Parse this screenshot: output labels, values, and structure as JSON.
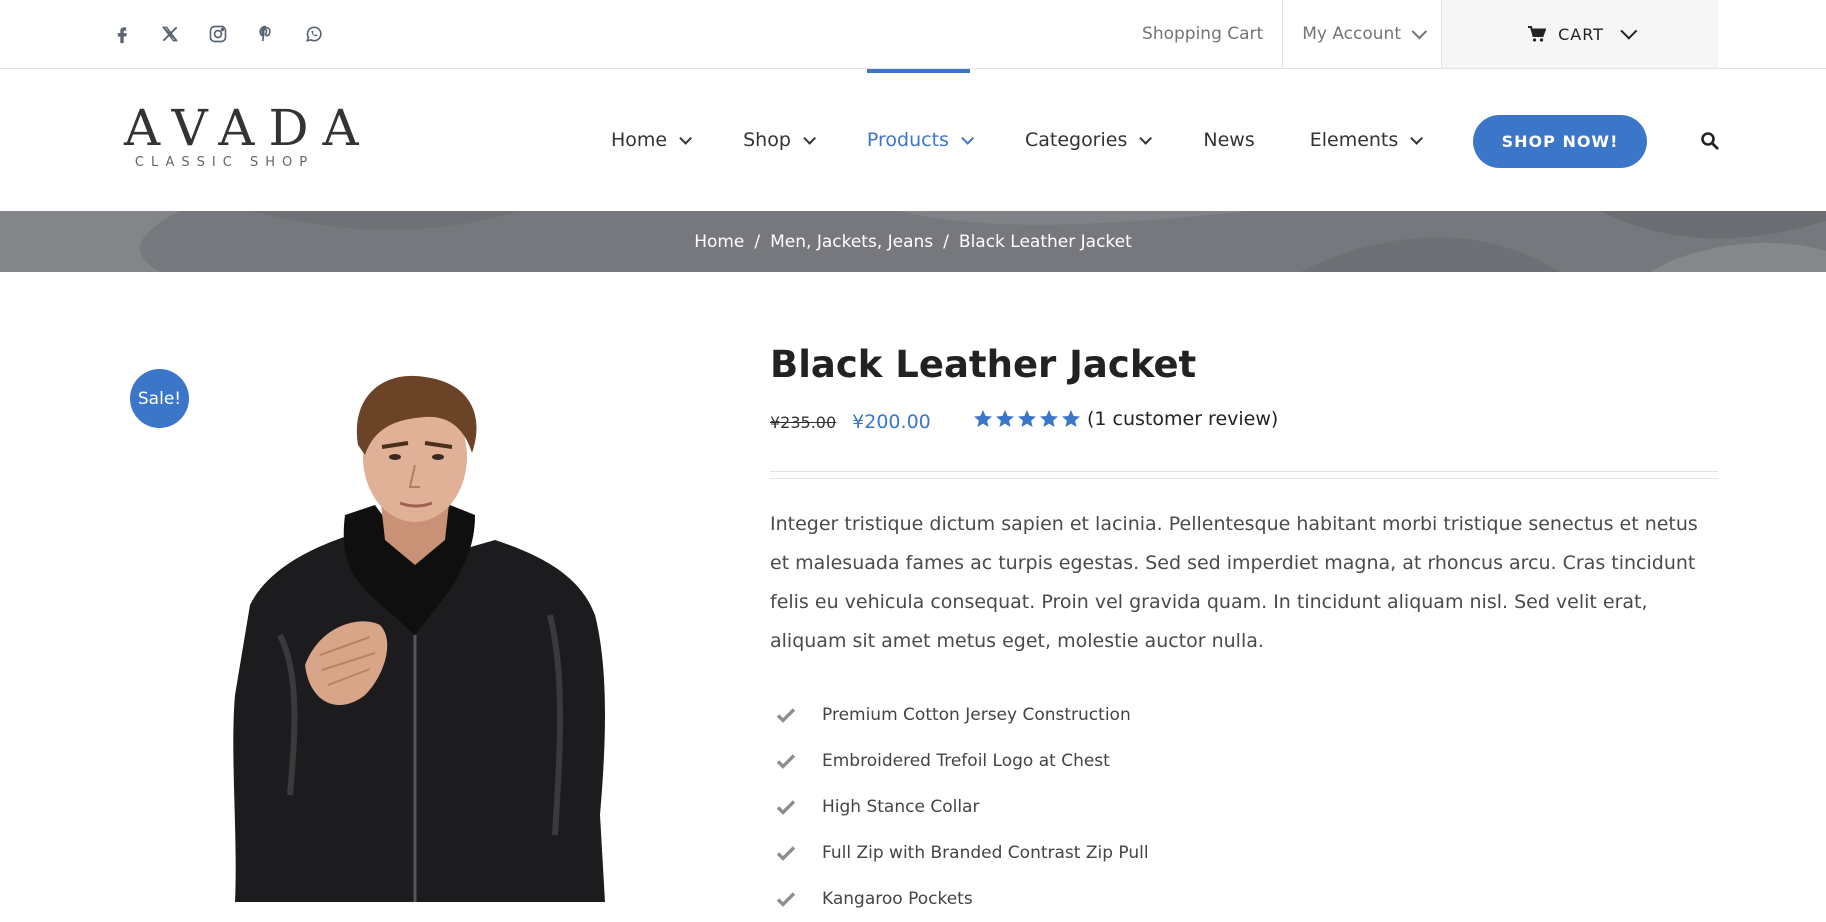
{
  "topbar": {
    "social": [
      "facebook-icon",
      "x-twitter-icon",
      "instagram-icon",
      "pinterest-icon",
      "whatsapp-icon"
    ],
    "links": {
      "shopping_cart": "Shopping Cart",
      "my_account": "My Account",
      "cart": "CART"
    }
  },
  "logo": {
    "brand": "AVADA",
    "sub": "CLASSIC SHOP"
  },
  "nav": {
    "items": [
      {
        "label": "Home",
        "has_dropdown": true
      },
      {
        "label": "Shop",
        "has_dropdown": true
      },
      {
        "label": "Products",
        "has_dropdown": true,
        "active": true
      },
      {
        "label": "Categories",
        "has_dropdown": true
      },
      {
        "label": "News",
        "has_dropdown": false
      },
      {
        "label": "Elements",
        "has_dropdown": true
      }
    ],
    "cta": "SHOP NOW!"
  },
  "breadcrumb": {
    "home": "Home",
    "category": "Men, Jackets, Jeans",
    "current": "Black Leather Jacket",
    "separator": "/"
  },
  "product": {
    "sale_badge": "Sale!",
    "title": "Black Leather Jacket",
    "old_price": "¥235.00",
    "new_price": "¥200.00",
    "rating": 5,
    "rating_max": 5,
    "review_text": "(1 customer review)",
    "description": "Integer tristique dictum sapien et lacinia. Pellentesque habitant morbi tristique senectus et netus et malesuada fames ac turpis egestas. Sed sed imperdiet magna, at rhoncus arcu. Cras tincidunt felis eu vehicula consequat. Proin vel gravida quam. In tincidunt aliquam nisl. Sed velit erat, aliquam sit amet metus eget, molestie auctor nulla.",
    "features": [
      "Premium Cotton Jersey Construction",
      "Embroidered Trefoil Logo at Chest",
      "High Stance Collar",
      "Full Zip with Branded Contrast Zip Pull",
      "Kangaroo Pockets"
    ]
  },
  "colors": {
    "accent": "#3b76c9",
    "text": "#333333",
    "breadcrumb_band": "#76787d",
    "muted": "#747474"
  }
}
